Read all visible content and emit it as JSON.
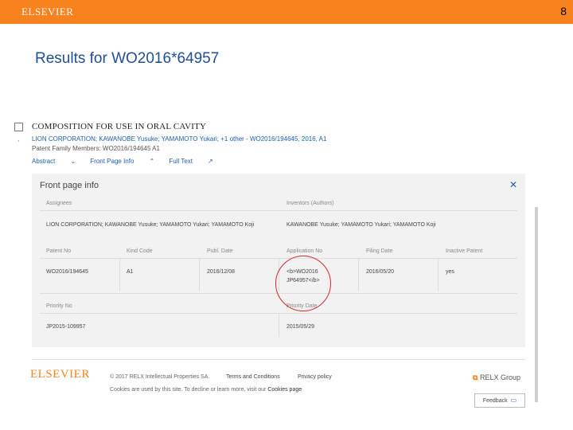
{
  "slide": {
    "number": "8"
  },
  "header": {
    "brand": "ELSEVIER"
  },
  "page_title": "Results for WO2016*64957",
  "result": {
    "title": "COMPOSITION FOR USE IN ORAL CAVITY",
    "authors": "LION CORPORATION; KAWANOBE Yusuke; YAMAMOTO Yukari; +1 other - WO2016/194645, 2016, A1",
    "family": "Patent Family Members: WO2016/194645 A1",
    "links": {
      "abstract": "Abstract",
      "front_page": "Front Page Info",
      "full_text": "Full Text"
    }
  },
  "panel": {
    "title": "Front page info",
    "assignees_label": "Assignees",
    "assignees_value": "LION CORPORATION; KAWANOBE Yusuke; YAMAMOTO Yukari; YAMAMOTO Koji",
    "inventors_label": "Inventors (Authors)",
    "inventors_value": "KAWANOBE Yusuke; YAMAMOTO Yukari; YAMAMOTO Koji",
    "columns": [
      "Patent No",
      "Kind Code",
      "Publ. Date",
      "Application No",
      "Filing Date",
      "Inactive Patent"
    ],
    "row": [
      "WO2016/194645",
      "A1",
      "2016/12/08",
      "<b>WO2016",
      "2016/05/20",
      "yes"
    ],
    "application_line2": "JP64957</b>",
    "priority_label": "Priority No",
    "priority_value": "JP2015-109957",
    "priority_date_label": "Priority Date",
    "priority_date_value": "2015/05/29"
  },
  "footer": {
    "logo": "ELSEVIER",
    "copyright": "© 2017 RELX Intellectual Properties SA.",
    "terms": "Terms and Conditions",
    "privacy": "Privacy policy",
    "cookie_prefix": "Cookies are used by this site. To decline or learn more, visit our",
    "cookie_link": "Cookies page",
    "relx": "RELX Group",
    "feedback": "Feedback"
  },
  "colors": {
    "brand_orange": "#f7821e",
    "link_blue": "#1d5fa8",
    "title_blue": "#1f4e9c",
    "highlight_red": "#d9262c"
  }
}
